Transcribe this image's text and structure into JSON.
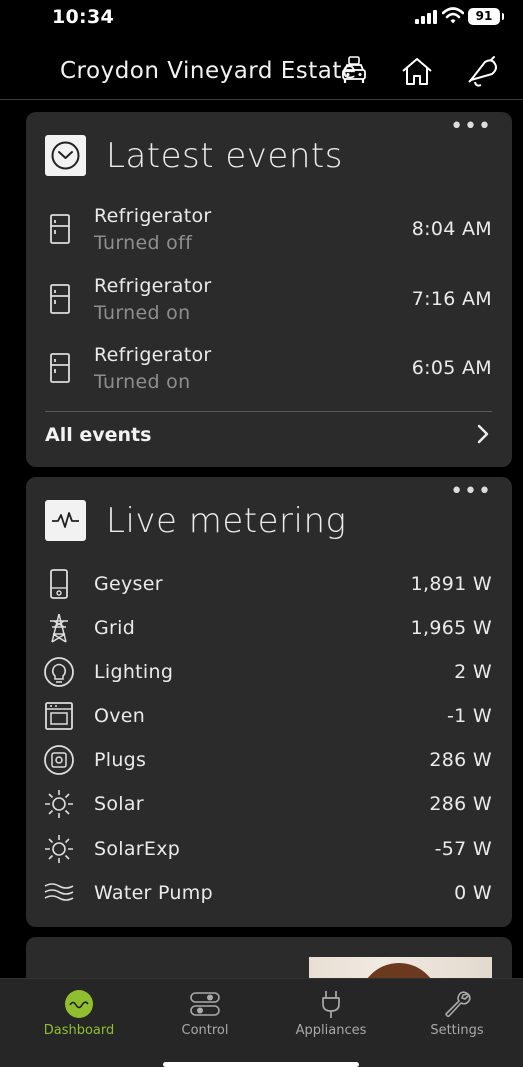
{
  "status_bar": {
    "time": "10:34",
    "battery": "91"
  },
  "header": {
    "title": "Croydon Vineyard Estate",
    "icons": [
      "car-icon",
      "home-icon",
      "bell-icon"
    ]
  },
  "events_card": {
    "title": "Latest events",
    "more": "•••",
    "events": [
      {
        "device": "Refrigerator",
        "status": "Turned off",
        "time": "8:04 AM",
        "icon": "refrigerator-icon"
      },
      {
        "device": "Refrigerator",
        "status": "Turned on",
        "time": "7:16 AM",
        "icon": "refrigerator-icon"
      },
      {
        "device": "Refrigerator",
        "status": "Turned on",
        "time": "6:05 AM",
        "icon": "refrigerator-icon"
      }
    ],
    "all_events_label": "All events"
  },
  "metering_card": {
    "title": "Live metering",
    "more": "•••",
    "items": [
      {
        "name": "Geyser",
        "value": "1,891 W",
        "icon": "geyser-icon"
      },
      {
        "name": "Grid",
        "value": "1,965 W",
        "icon": "pylon-icon"
      },
      {
        "name": "Lighting",
        "value": "2 W",
        "icon": "bulb-icon"
      },
      {
        "name": "Oven",
        "value": "-1 W",
        "icon": "oven-icon"
      },
      {
        "name": "Plugs",
        "value": "286 W",
        "icon": "plug-socket-icon"
      },
      {
        "name": "Solar",
        "value": "286 W",
        "icon": "sun-icon"
      },
      {
        "name": "SolarExp",
        "value": "-57 W",
        "icon": "sun-icon"
      },
      {
        "name": "Water Pump",
        "value": "0 W",
        "icon": "water-icon"
      }
    ]
  },
  "tabbar": {
    "tabs": [
      {
        "label": "Dashboard",
        "active": true,
        "icon": "dashboard-icon"
      },
      {
        "label": "Control",
        "active": false,
        "icon": "toggles-icon"
      },
      {
        "label": "Appliances",
        "active": false,
        "icon": "plug-icon"
      },
      {
        "label": "Settings",
        "active": false,
        "icon": "wrench-icon"
      }
    ]
  },
  "colors": {
    "accent": "#8fbf2f",
    "card": "#2b2b2b",
    "background": "#000000"
  }
}
